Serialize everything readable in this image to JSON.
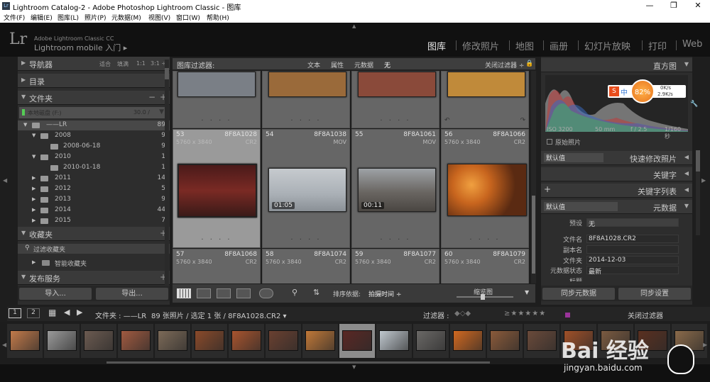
{
  "window": {
    "title": "Lightroom Catalog-2 - Adobe Photoshop Lightroom Classic - 图库",
    "controls": [
      "minimize",
      "maximize",
      "close"
    ]
  },
  "menu": [
    "文件(F)",
    "编辑(E)",
    "图库(L)",
    "照片(P)",
    "元数据(M)",
    "视图(V)",
    "窗口(W)",
    "帮助(H)"
  ],
  "identity": {
    "logo": "Lr",
    "cc": "Adobe Lightroom Classic CC",
    "mobile": "Lightroom mobile 入门 ▸"
  },
  "modules": [
    {
      "label": "图库",
      "active": true
    },
    {
      "label": "修改照片"
    },
    {
      "label": "地图"
    },
    {
      "label": "画册"
    },
    {
      "label": "幻灯片放映"
    },
    {
      "label": "打印"
    },
    {
      "label": "Web"
    }
  ],
  "left": {
    "navigator": {
      "label": "导航器",
      "zoom": [
        "适合",
        "填满",
        "1:1",
        "3:1 ÷"
      ]
    },
    "catalog": {
      "label": "目录"
    },
    "folders": {
      "label": "文件夹",
      "minus": "−",
      "plus": "+",
      "volume": "本地磁盘 (F:)",
      "volume_size": "30.0 / ",
      "rows": [
        {
          "name": "——LR",
          "count": "89"
        },
        {
          "name": "2008",
          "count": "9"
        },
        {
          "name": "2008-06-18",
          "count": "9"
        },
        {
          "name": "2010",
          "count": "1"
        },
        {
          "name": "2010-01-18",
          "count": "1"
        },
        {
          "name": "2011",
          "count": "14"
        },
        {
          "name": "2012",
          "count": "5"
        },
        {
          "name": "2013",
          "count": "9"
        },
        {
          "name": "2014",
          "count": "44"
        },
        {
          "name": "2015",
          "count": "7"
        }
      ]
    },
    "collections": {
      "label": "收藏夹",
      "plus": "+",
      "items": [
        "过滤收藏夹",
        "智能收藏夹"
      ]
    },
    "publish": {
      "label": "发布服务",
      "plus": "+"
    },
    "import_btn": "导入...",
    "export_btn": "导出..."
  },
  "filterbar": {
    "label": "图库过滤器:",
    "opts": [
      "文本",
      "属性",
      "元数据",
      "无"
    ],
    "off": "关闭过滤器 ÷"
  },
  "grid": [
    {
      "idx": "53",
      "file": "8F8A1028",
      "dim": "5760 x 3840",
      "ext": "CR2",
      "dur": "",
      "selected": true,
      "color": "#6a2a22"
    },
    {
      "idx": "54",
      "file": "8F8A1038",
      "dim": "",
      "ext": "MOV",
      "dur": "01:05",
      "color": "#b7bcc2"
    },
    {
      "idx": "55",
      "file": "8F8A1061",
      "dim": "",
      "ext": "MOV",
      "dur": "00:11",
      "color": "#6c6a66"
    },
    {
      "idx": "56",
      "file": "8F8A1066",
      "dim": "5760 x 3840",
      "ext": "CR2",
      "dur": "",
      "color": "#c8651e"
    },
    {
      "idx": "57",
      "file": "8F8A1068",
      "dim": "5760 x 3840",
      "ext": "CR2"
    },
    {
      "idx": "58",
      "file": "8F8A1074",
      "dim": "5760 x 3840",
      "ext": "CR2"
    },
    {
      "idx": "59",
      "file": "8F8A1077",
      "dim": "5760 x 3840",
      "ext": "CR2"
    },
    {
      "idx": "60",
      "file": "8F8A1079",
      "dim": "5760 x 3840",
      "ext": "CR2"
    }
  ],
  "toolbar": {
    "sort_label": "排序依据:",
    "sort_value": "拍摄时间 ÷",
    "thumb_label": "缩览图"
  },
  "right": {
    "histogram": {
      "label": "直方图",
      "iso": "ISO 3200",
      "focal": "50 mm",
      "aperture": "f / 2.5",
      "shutter": "1/160 秒",
      "orig": "原始照片",
      "net_pct": "82%",
      "net_up": "0K/s",
      "net_down": "2.9K/s"
    },
    "quick": {
      "preset": "默认值",
      "label": "快速修改照片"
    },
    "keywords": {
      "label": "关键字"
    },
    "keyword_list": {
      "label": "关键字列表",
      "plus": "+"
    },
    "metadata": {
      "preset": "默认值",
      "label": "元数据",
      "preset_label": "预设",
      "preset_val": "无",
      "fields": [
        {
          "k": "文件名",
          "v": "8F8A1028.CR2"
        },
        {
          "k": "副本名",
          "v": ""
        },
        {
          "k": "文件夹",
          "v": "2014-12-03"
        },
        {
          "k": "元数据状态",
          "v": "最新"
        },
        {
          "k": "标题",
          "v": ""
        }
      ]
    },
    "sync_meta": "同步元数据",
    "sync_settings": "同步设置"
  },
  "filmbar": {
    "screen1": "1",
    "screen2": "2",
    "path": "文件夹 : ——LR",
    "count": "89 张照片 / 选定 1 张 / 8F8A1028.CR2 ▾",
    "filter": "过滤器 :",
    "filter_off": "关闭过滤器"
  },
  "filmstrip_colors": [
    "#c27a4a",
    "#9a9a9a",
    "#6b5a50",
    "#a05a40",
    "#7c6a58",
    "#8a4a2a",
    "#a8542e",
    "#6a4030",
    "#c07838",
    "#5a2824",
    "#c0c8cf",
    "#6a6866",
    "#d06820",
    "#8a5a3a",
    "#6a4a3a",
    "#a05028",
    "#7a5a40",
    "#5a3020",
    "#8a6a4a"
  ],
  "watermark": {
    "text": "Bai 经验",
    "sub": "jingyan.baidu.com"
  }
}
